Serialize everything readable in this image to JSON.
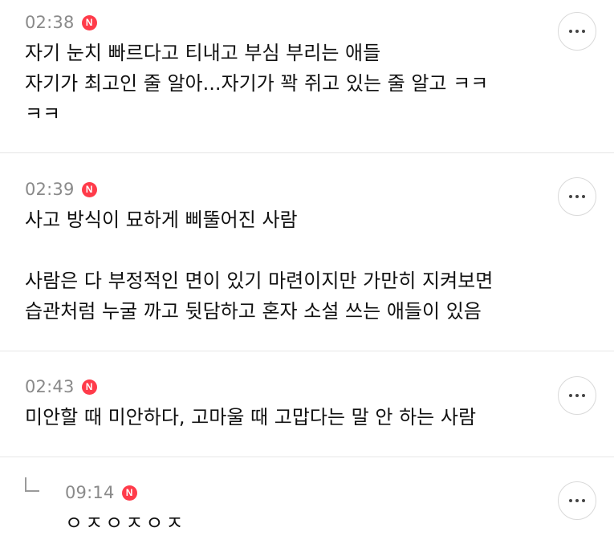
{
  "comments": [
    {
      "time": "02:38",
      "badge": "N",
      "text": "자기 눈치 빠르다고 티내고 부심 부리는 애들\n자기가 최고인 줄 알아...자기가 꽉 쥐고 있는 줄 알고 ㅋㅋ\nㅋㅋ",
      "more_label": "more options"
    },
    {
      "time": "02:39",
      "badge": "N",
      "text": "사고 방식이 묘하게 삐뚤어진 사람\n\n사람은 다 부정적인 면이 있기 마련이지만 가만히 지켜보면\n습관처럼 누굴 까고 뒷담하고 혼자 소설 쓰는 애들이 있음",
      "more_label": "more options"
    },
    {
      "time": "02:43",
      "badge": "N",
      "text": "미안할 때 미안하다, 고마울 때 고맙다는 말 안 하는 사람",
      "more_label": "more options"
    }
  ],
  "reply": {
    "time": "09:14",
    "badge": "N",
    "text": "ㅇㅈㅇㅈㅇㅈ",
    "more_label": "more options"
  }
}
